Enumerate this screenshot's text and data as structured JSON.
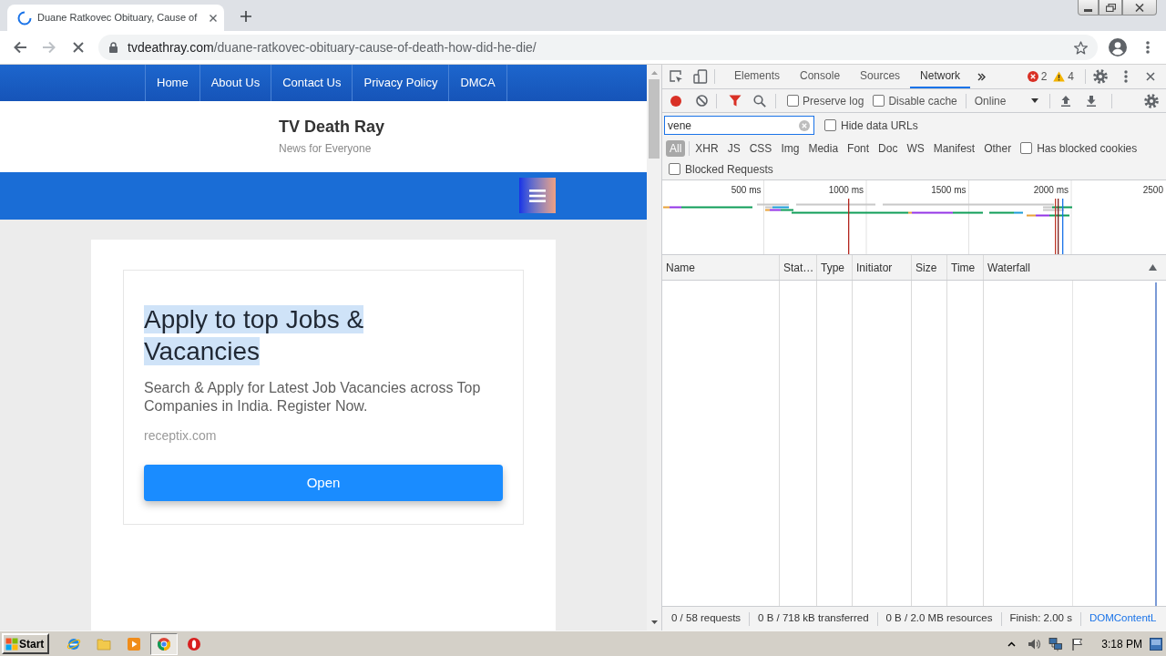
{
  "browser": {
    "tabs": [
      {
        "title": "Duane Ratkovec Obituary, Cause of",
        "selected": true,
        "loading": true
      }
    ],
    "loading": true,
    "address": {
      "domain": "tvdeathray.com",
      "path": "/duane-ratkovec-obituary-cause-of-death-how-did-he-die/"
    }
  },
  "page": {
    "nav": [
      "Home",
      "About Us",
      "Contact Us",
      "Privacy Policy",
      "DMCA"
    ],
    "site_title": "TV Death Ray",
    "tagline": "News for Everyone",
    "ad": {
      "heading": "Apply to top Jobs & Vacancies",
      "heading_selected": true,
      "description": "Search & Apply for Latest Job Vacancies across Top Companies in India. Register Now.",
      "domain": "receptix.com",
      "button": "Open"
    }
  },
  "devtools": {
    "tabs": [
      {
        "label": "Elements",
        "selected": false
      },
      {
        "label": "Console",
        "selected": false
      },
      {
        "label": "Sources",
        "selected": false
      },
      {
        "label": "Network",
        "selected": true
      }
    ],
    "errors": "2",
    "warnings": "4",
    "recording": true,
    "options": [
      {
        "label": "Preserve log",
        "checked": false
      },
      {
        "label": "Disable cache",
        "checked": false
      }
    ],
    "throttling": "Online",
    "filter": {
      "value": "vene"
    },
    "hide_data_urls": {
      "label": "Hide data URLs",
      "checked": false
    },
    "type_filters": [
      {
        "label": "All",
        "selected": true
      },
      {
        "label": "XHR",
        "selected": false
      },
      {
        "label": "JS",
        "selected": false
      },
      {
        "label": "CSS",
        "selected": false
      },
      {
        "label": "Img",
        "selected": false
      },
      {
        "label": "Media",
        "selected": false
      },
      {
        "label": "Font",
        "selected": false
      },
      {
        "label": "Doc",
        "selected": false
      },
      {
        "label": "WS",
        "selected": false
      },
      {
        "label": "Manifest",
        "selected": false
      },
      {
        "label": "Other",
        "selected": false
      }
    ],
    "has_blocked_cookies": {
      "label": "Has blocked cookies",
      "checked": false
    },
    "blocked_requests": {
      "label": "Blocked Requests",
      "checked": false
    },
    "overview": {
      "ticks": [
        "500 ms",
        "1000 ms",
        "1500 ms",
        "2000 ms",
        "2500"
      ]
    },
    "table": {
      "columns": [
        {
          "label": "Name",
          "sorted": false
        },
        {
          "label": "Stat…",
          "sorted": false
        },
        {
          "label": "Type",
          "sorted": false
        },
        {
          "label": "Initiator",
          "sorted": false
        },
        {
          "label": "Size",
          "sorted": false
        },
        {
          "label": "Time",
          "sorted": false
        },
        {
          "label": "Waterfall",
          "sorted": true
        }
      ]
    },
    "status_bar": [
      {
        "text": "0 / 58 requests",
        "color": "#333333"
      },
      {
        "text": "0 B / 718 kB transferred",
        "color": "#333333"
      },
      {
        "text": "0 B / 2.0 MB resources",
        "color": "#333333"
      },
      {
        "text": "Finish: 2.00 s",
        "color": "#333333"
      },
      {
        "text": "DOMContentL",
        "color": "#1a73e8"
      }
    ]
  },
  "taskbar": {
    "start": "Start",
    "apps": [
      {
        "kind": "globe",
        "selected": false
      },
      {
        "kind": "folder",
        "selected": false
      },
      {
        "kind": "player",
        "selected": false
      },
      {
        "kind": "ring",
        "selected": true
      },
      {
        "kind": "disc",
        "selected": false
      }
    ],
    "clock": "3:18 PM"
  }
}
